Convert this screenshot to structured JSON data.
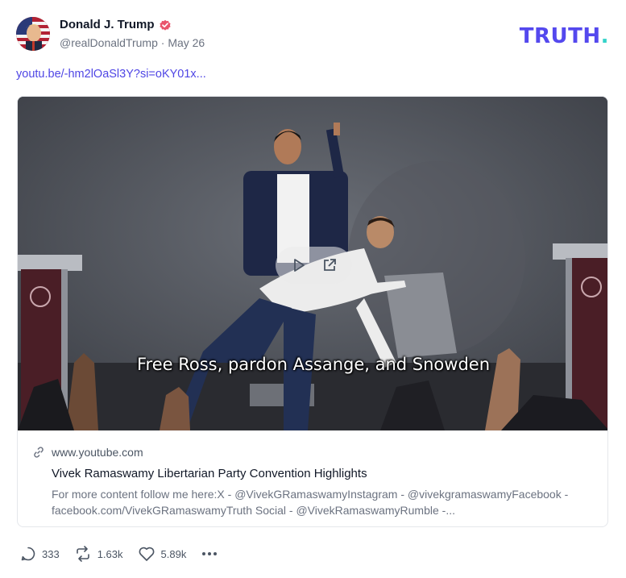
{
  "post": {
    "author_name": "Donald J. Trump",
    "handle": "@realDonaldTrump",
    "separator": "·",
    "date": "May 26",
    "brand_logo_main": "TRUTH",
    "brand_logo_dot": ".",
    "link_text": "youtu.be/-hm2lOaSl3Y?si=oKY01x..."
  },
  "card": {
    "video_subtitle": "Free Ross, pardon Assange, and Snowden",
    "domain": "www.youtube.com",
    "title": "Vivek Ramaswamy Libertarian Party Convention Highlights",
    "description": "For more content follow me here:X - @VivekGRamaswamyInstagram - @vivekgramaswamyFacebook - facebook.com/VivekGRamaswamyTruth Social - @VivekRamaswamyRumble -..."
  },
  "actions": {
    "replies": "333",
    "retruths": "1.63k",
    "likes": "5.89k"
  },
  "colors": {
    "brand": "#5448ee",
    "brand_dot": "#34d3c9",
    "link": "#4f46e5",
    "verified": "#e9546b"
  },
  "icons": [
    "verified-badge-icon",
    "play-icon",
    "external-link-icon",
    "link-icon",
    "reply-icon",
    "retruth-icon",
    "heart-icon",
    "more-icon"
  ]
}
